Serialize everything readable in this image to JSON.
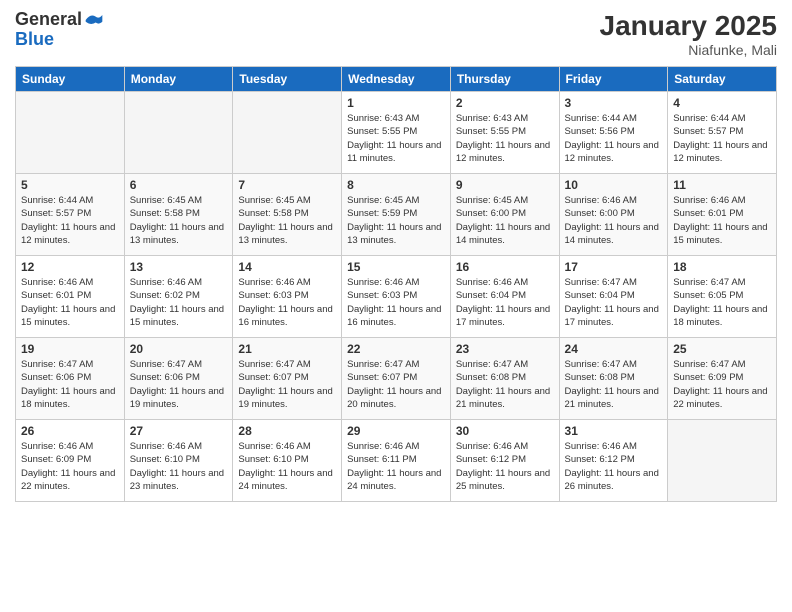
{
  "header": {
    "logo_general": "General",
    "logo_blue": "Blue",
    "month_title": "January 2025",
    "location": "Niafunke, Mali"
  },
  "weekdays": [
    "Sunday",
    "Monday",
    "Tuesday",
    "Wednesday",
    "Thursday",
    "Friday",
    "Saturday"
  ],
  "weeks": [
    [
      {
        "day": "",
        "empty": true
      },
      {
        "day": "",
        "empty": true
      },
      {
        "day": "",
        "empty": true
      },
      {
        "day": "1",
        "sunrise": "6:43 AM",
        "sunset": "5:55 PM",
        "daylight": "11 hours and 11 minutes."
      },
      {
        "day": "2",
        "sunrise": "6:43 AM",
        "sunset": "5:55 PM",
        "daylight": "11 hours and 12 minutes."
      },
      {
        "day": "3",
        "sunrise": "6:44 AM",
        "sunset": "5:56 PM",
        "daylight": "11 hours and 12 minutes."
      },
      {
        "day": "4",
        "sunrise": "6:44 AM",
        "sunset": "5:57 PM",
        "daylight": "11 hours and 12 minutes."
      }
    ],
    [
      {
        "day": "5",
        "sunrise": "6:44 AM",
        "sunset": "5:57 PM",
        "daylight": "11 hours and 12 minutes."
      },
      {
        "day": "6",
        "sunrise": "6:45 AM",
        "sunset": "5:58 PM",
        "daylight": "11 hours and 13 minutes."
      },
      {
        "day": "7",
        "sunrise": "6:45 AM",
        "sunset": "5:58 PM",
        "daylight": "11 hours and 13 minutes."
      },
      {
        "day": "8",
        "sunrise": "6:45 AM",
        "sunset": "5:59 PM",
        "daylight": "11 hours and 13 minutes."
      },
      {
        "day": "9",
        "sunrise": "6:45 AM",
        "sunset": "6:00 PM",
        "daylight": "11 hours and 14 minutes."
      },
      {
        "day": "10",
        "sunrise": "6:46 AM",
        "sunset": "6:00 PM",
        "daylight": "11 hours and 14 minutes."
      },
      {
        "day": "11",
        "sunrise": "6:46 AM",
        "sunset": "6:01 PM",
        "daylight": "11 hours and 15 minutes."
      }
    ],
    [
      {
        "day": "12",
        "sunrise": "6:46 AM",
        "sunset": "6:01 PM",
        "daylight": "11 hours and 15 minutes."
      },
      {
        "day": "13",
        "sunrise": "6:46 AM",
        "sunset": "6:02 PM",
        "daylight": "11 hours and 15 minutes."
      },
      {
        "day": "14",
        "sunrise": "6:46 AM",
        "sunset": "6:03 PM",
        "daylight": "11 hours and 16 minutes."
      },
      {
        "day": "15",
        "sunrise": "6:46 AM",
        "sunset": "6:03 PM",
        "daylight": "11 hours and 16 minutes."
      },
      {
        "day": "16",
        "sunrise": "6:46 AM",
        "sunset": "6:04 PM",
        "daylight": "11 hours and 17 minutes."
      },
      {
        "day": "17",
        "sunrise": "6:47 AM",
        "sunset": "6:04 PM",
        "daylight": "11 hours and 17 minutes."
      },
      {
        "day": "18",
        "sunrise": "6:47 AM",
        "sunset": "6:05 PM",
        "daylight": "11 hours and 18 minutes."
      }
    ],
    [
      {
        "day": "19",
        "sunrise": "6:47 AM",
        "sunset": "6:06 PM",
        "daylight": "11 hours and 18 minutes."
      },
      {
        "day": "20",
        "sunrise": "6:47 AM",
        "sunset": "6:06 PM",
        "daylight": "11 hours and 19 minutes."
      },
      {
        "day": "21",
        "sunrise": "6:47 AM",
        "sunset": "6:07 PM",
        "daylight": "11 hours and 19 minutes."
      },
      {
        "day": "22",
        "sunrise": "6:47 AM",
        "sunset": "6:07 PM",
        "daylight": "11 hours and 20 minutes."
      },
      {
        "day": "23",
        "sunrise": "6:47 AM",
        "sunset": "6:08 PM",
        "daylight": "11 hours and 21 minutes."
      },
      {
        "day": "24",
        "sunrise": "6:47 AM",
        "sunset": "6:08 PM",
        "daylight": "11 hours and 21 minutes."
      },
      {
        "day": "25",
        "sunrise": "6:47 AM",
        "sunset": "6:09 PM",
        "daylight": "11 hours and 22 minutes."
      }
    ],
    [
      {
        "day": "26",
        "sunrise": "6:46 AM",
        "sunset": "6:09 PM",
        "daylight": "11 hours and 22 minutes."
      },
      {
        "day": "27",
        "sunrise": "6:46 AM",
        "sunset": "6:10 PM",
        "daylight": "11 hours and 23 minutes."
      },
      {
        "day": "28",
        "sunrise": "6:46 AM",
        "sunset": "6:10 PM",
        "daylight": "11 hours and 24 minutes."
      },
      {
        "day": "29",
        "sunrise": "6:46 AM",
        "sunset": "6:11 PM",
        "daylight": "11 hours and 24 minutes."
      },
      {
        "day": "30",
        "sunrise": "6:46 AM",
        "sunset": "6:12 PM",
        "daylight": "11 hours and 25 minutes."
      },
      {
        "day": "31",
        "sunrise": "6:46 AM",
        "sunset": "6:12 PM",
        "daylight": "11 hours and 26 minutes."
      },
      {
        "day": "",
        "empty": true
      }
    ]
  ],
  "labels": {
    "sunrise": "Sunrise:",
    "sunset": "Sunset:",
    "daylight": "Daylight:"
  }
}
